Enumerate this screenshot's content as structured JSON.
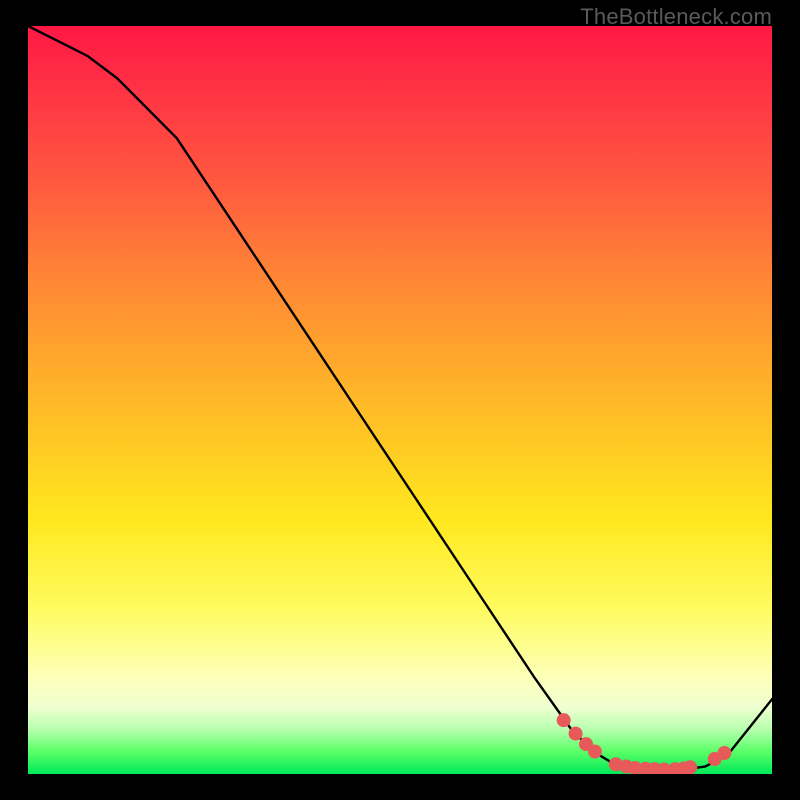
{
  "watermark": "TheBottleneck.com",
  "colors": {
    "curve": "#000000",
    "dot_fill": "#e85a5a",
    "dot_stroke": "#c84444"
  },
  "chart_data": {
    "type": "line",
    "title": "",
    "xlabel": "",
    "ylabel": "",
    "xlim": [
      0,
      100
    ],
    "ylim": [
      0,
      100
    ],
    "series": [
      {
        "name": "curve",
        "x": [
          0,
          4,
          8,
          12,
          16,
          20,
          28,
          36,
          44,
          52,
          60,
          68,
          73,
          76,
          79,
          82,
          85,
          88,
          91,
          94,
          100
        ],
        "y": [
          100,
          98,
          96,
          93,
          89,
          85,
          73,
          61,
          49,
          37,
          25,
          13,
          6,
          3,
          1.2,
          0.6,
          0.5,
          0.6,
          1.0,
          2.5,
          10
        ]
      }
    ],
    "markers": {
      "name": "highlight-dots",
      "x": [
        72.0,
        73.6,
        75.0,
        76.2,
        79.0,
        80.4,
        81.6,
        83.0,
        84.2,
        85.5,
        87.0,
        88.2,
        89.0,
        92.3,
        93.6
      ],
      "y": [
        7.2,
        5.4,
        4.0,
        3.0,
        1.3,
        1.0,
        0.8,
        0.7,
        0.65,
        0.6,
        0.65,
        0.75,
        0.9,
        2.0,
        2.8
      ]
    }
  }
}
